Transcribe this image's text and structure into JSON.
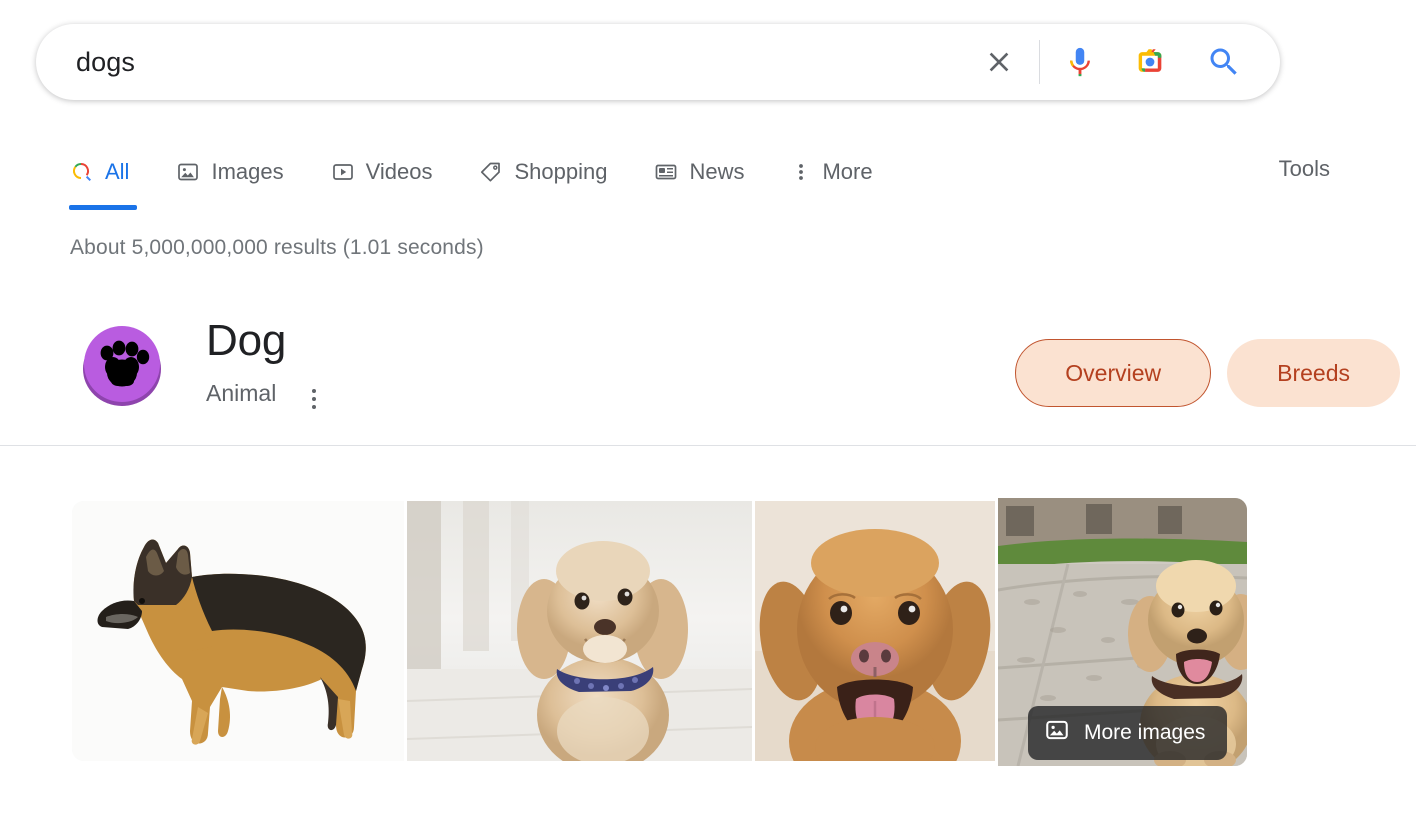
{
  "search": {
    "query": "dogs",
    "placeholder": "Search",
    "clear_label": "Clear",
    "voice_label": "Search by voice",
    "lens_label": "Search by image",
    "submit_label": "Google Search"
  },
  "nav": {
    "tabs": [
      {
        "label": "All",
        "icon": "google-search-icon",
        "active": true
      },
      {
        "label": "Images",
        "icon": "image-icon",
        "active": false
      },
      {
        "label": "Videos",
        "icon": "video-icon",
        "active": false
      },
      {
        "label": "Shopping",
        "icon": "tag-icon",
        "active": false
      },
      {
        "label": "News",
        "icon": "newspaper-icon",
        "active": false
      },
      {
        "label": "More",
        "icon": "more-vert-icon",
        "active": false
      }
    ],
    "tools_label": "Tools"
  },
  "results": {
    "stats": "About 5,000,000,000 results (1.01 seconds)"
  },
  "knowledge_panel": {
    "badge_icon": "paw-print-icon",
    "title": "Dog",
    "subtitle": "Animal",
    "more_options_label": "More options",
    "chips": [
      {
        "label": "Overview",
        "selected": true
      },
      {
        "label": "Breeds",
        "selected": false
      }
    ]
  },
  "image_strip": {
    "thumbnails": [
      {
        "alt": "German Shepherd standing in profile on white background"
      },
      {
        "alt": "Cream cockapoo puppy with blue collar sitting outdoors"
      },
      {
        "alt": "Golden retriever face close-up with tongue out"
      },
      {
        "alt": "Golden retriever puppy on paved path in front of a house"
      }
    ],
    "more_images_label": "More images",
    "more_images_icon": "image-icon"
  },
  "colors": {
    "google_blue": "#1a73e8",
    "google_red": "#ea4335",
    "google_yellow": "#fbbc05",
    "google_green": "#34a853",
    "chip_bg": "#fbe2d1",
    "chip_text": "#b4401f",
    "chip_border": "#c1552f",
    "badge_purple": "#b95ce0",
    "text_primary": "#202124",
    "text_secondary": "#5f6368",
    "text_stats": "#70757a",
    "divider": "#dfe1e5"
  }
}
